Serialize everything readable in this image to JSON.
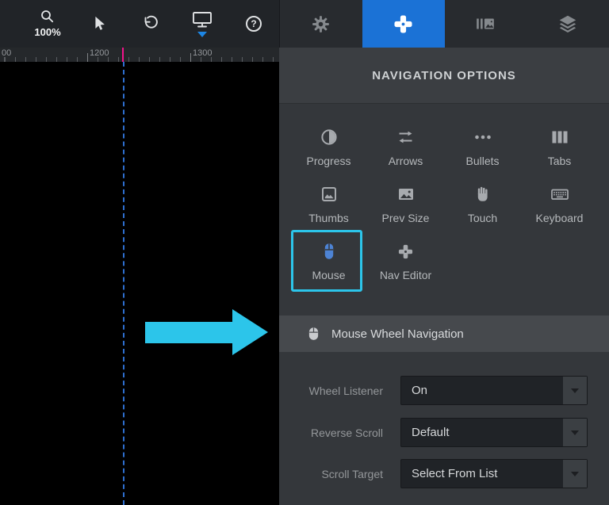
{
  "toolbar": {
    "zoom_label": "100%",
    "help_glyph": "?"
  },
  "tabs": [
    {
      "id": "settings",
      "active": false
    },
    {
      "id": "navigation",
      "active": true
    },
    {
      "id": "slides",
      "active": false
    },
    {
      "id": "layers",
      "active": false
    }
  ],
  "ruler": {
    "labels": [
      "00",
      "1200",
      "1300"
    ]
  },
  "panel": {
    "title": "NAVIGATION OPTIONS",
    "nav_types": [
      {
        "label": "Progress"
      },
      {
        "label": "Arrows"
      },
      {
        "label": "Bullets"
      },
      {
        "label": "Tabs"
      },
      {
        "label": "Thumbs"
      },
      {
        "label": "Prev Size"
      },
      {
        "label": "Touch"
      },
      {
        "label": "Keyboard"
      },
      {
        "label": "Mouse",
        "selected": true
      },
      {
        "label": "Nav Editor"
      }
    ],
    "section_title": "Mouse Wheel Navigation",
    "fields": [
      {
        "label": "Wheel Listener",
        "value": "On"
      },
      {
        "label": "Reverse Scroll",
        "value": "Default"
      },
      {
        "label": "Scroll Target",
        "value": "Select From List"
      }
    ]
  },
  "colors": {
    "accent_blue": "#1b72d6",
    "annotation_cyan": "#2cc5ea",
    "ruler_marker_pink": "#f2138b"
  }
}
